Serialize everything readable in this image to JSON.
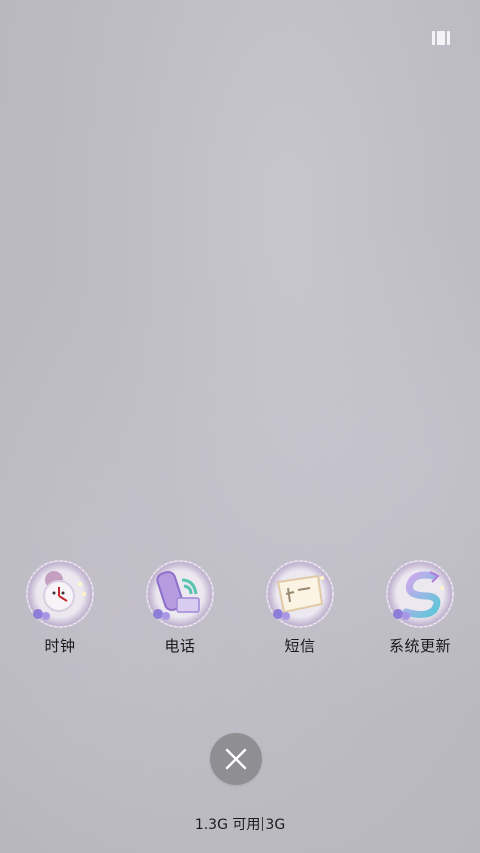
{
  "status": {
    "multi_window_icon": "multi-window-icon"
  },
  "recent_apps": [
    {
      "label": "时钟",
      "icon": "clock-icon"
    },
    {
      "label": "电话",
      "icon": "phone-icon"
    },
    {
      "label": "短信",
      "icon": "sms-icon"
    },
    {
      "label": "系统更新",
      "icon": "system-update-icon"
    }
  ],
  "close_button": {
    "icon": "close-icon"
  },
  "memory": {
    "available": "1.3G 可用",
    "total": "3G"
  },
  "colors": {
    "background": "#bdbcc3",
    "close_button": "#8e8e93",
    "text": "#1a1a1a"
  }
}
